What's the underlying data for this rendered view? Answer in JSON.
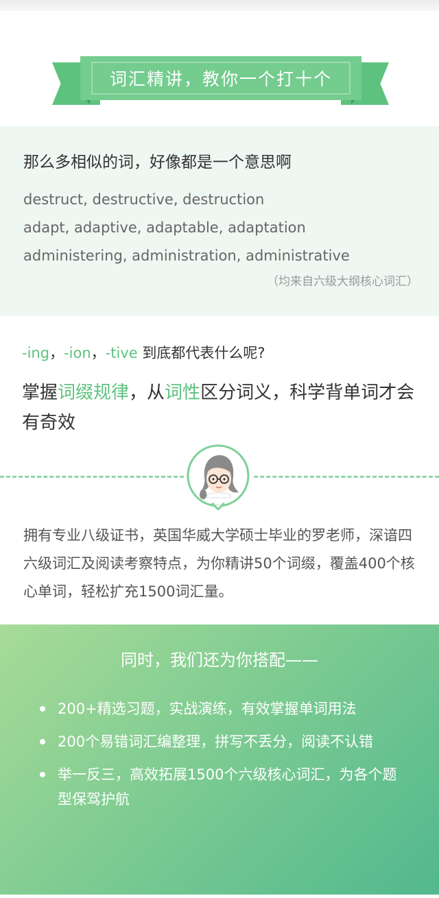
{
  "banner": {
    "title": "词汇精讲，教你一个打十个"
  },
  "similar": {
    "heading": "那么多相似的词，好像都是一个意思啊",
    "lines": [
      "destruct, destructive, destruction",
      "adapt, adaptive, adaptable, adaptation",
      "administering, administration, administrative"
    ],
    "note": "（均来自六级大纲核心词汇）"
  },
  "suffix": {
    "s1": "-ing",
    "sep1": "，",
    "s2": "-ion",
    "sep2": "，",
    "s3": "-tive",
    "rest": " 到底都代表什么呢?"
  },
  "tagline": {
    "p1": "掌握",
    "hl1": "词缀规律",
    "p2": "，从",
    "hl2": "词性",
    "p3": "区分词义，科学背单词才会有奇效"
  },
  "teacher": {
    "intro": "拥有专业八级证书，英国华威大学硕士毕业的罗老师，深谙四六级词汇及阅读考察特点，为你精讲50个词缀，覆盖400个核心单词，轻松扩充1500词汇量。"
  },
  "bonus": {
    "title": "同时，我们还为你搭配——",
    "items": [
      "200+精选习题，实战演练，有效掌握单词用法",
      "200个易错词汇编整理，拼写不丢分，阅读不认错",
      "举一反三，高效拓展1500个六级核心词汇，为各个题型保驾护航"
    ]
  },
  "colors": {
    "accent": "#5ec27f",
    "ribbon": "#74cc8f",
    "panel": "#eff7f2"
  }
}
